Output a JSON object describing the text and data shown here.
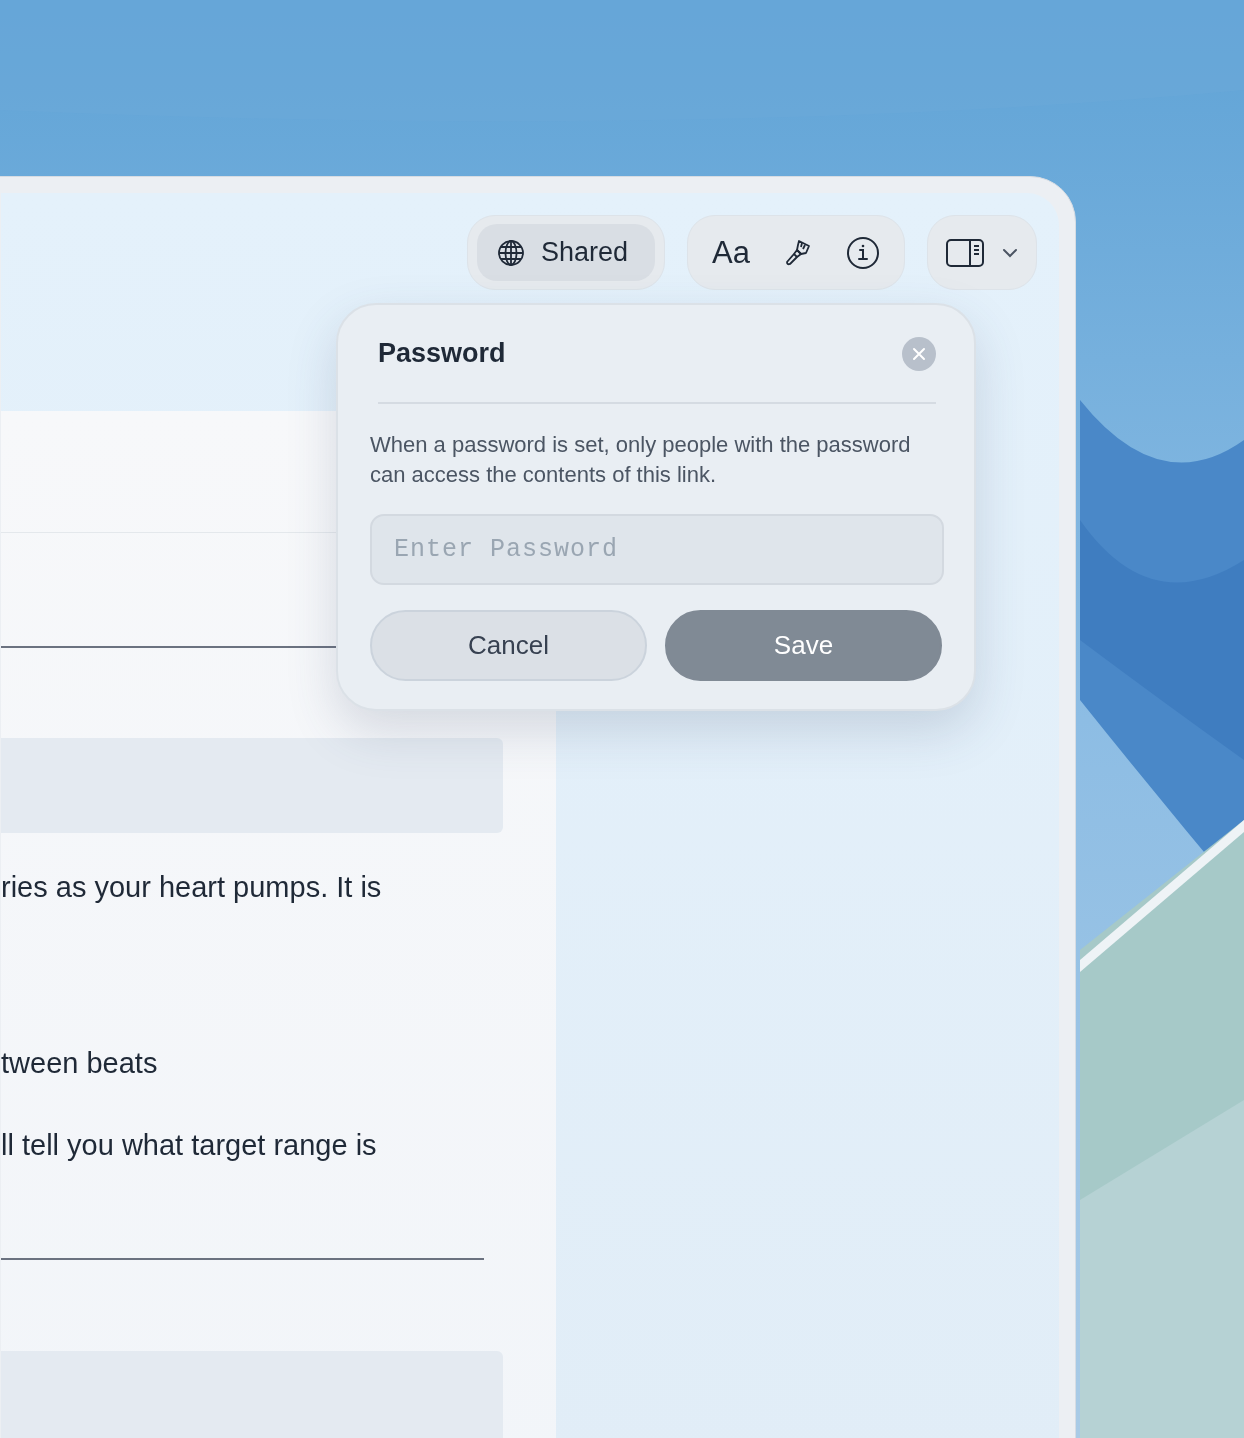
{
  "toolbar": {
    "share_button": {
      "label": "Shared",
      "selected": true
    },
    "format_button": {
      "label": "Aa"
    }
  },
  "document": {
    "paragraphs": [
      {
        "kind": "block"
      },
      {
        "kind": "text",
        "text": "ries as your heart pumps. It is"
      },
      {
        "kind": "text",
        "text": "tween beats"
      },
      {
        "kind": "text",
        "text": "ll tell you what target range is"
      },
      {
        "kind": "rule"
      },
      {
        "kind": "block"
      }
    ]
  },
  "popover": {
    "title": "Password",
    "description": "When a password is set, only people with the password can access the contents of this link.",
    "password_field": {
      "placeholder": "Enter Password"
    },
    "buttons": [
      {
        "label": "Cancel",
        "kind": "secondary"
      },
      {
        "label": "Save",
        "kind": "primary"
      }
    ]
  }
}
